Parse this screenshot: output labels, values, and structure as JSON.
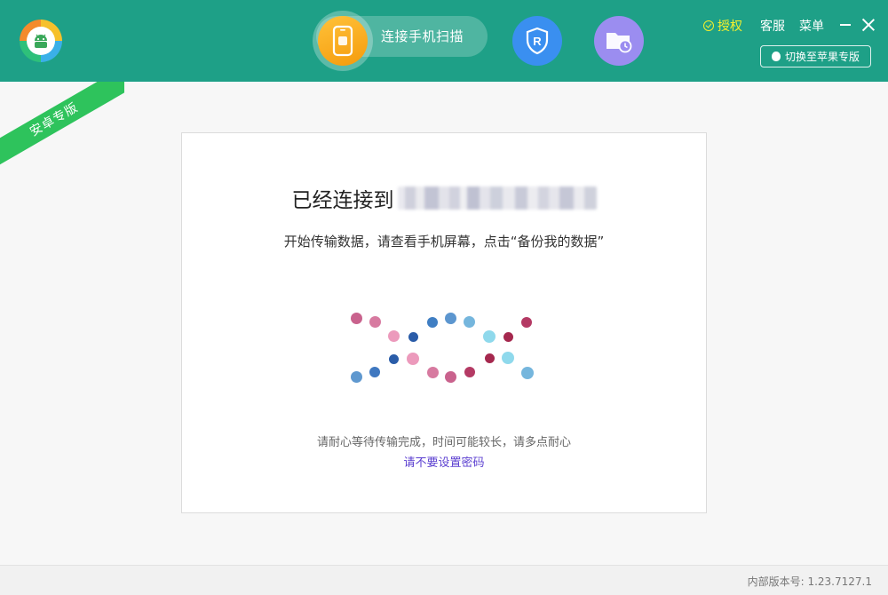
{
  "header": {
    "scan_label": "连接手机扫描",
    "auth_label": "授权",
    "service_label": "客服",
    "menu_label": "菜单",
    "switch_label": "切换至苹果专版"
  },
  "ribbon": {
    "label": "安卓专版"
  },
  "card": {
    "title": "已经连接到",
    "subtitle": "开始传输数据，请查看手机屏幕，点击“备份我的数据”",
    "note": "请耐心等待传输完成，时间可能较长，请多点耐心",
    "password_link": "请不要设置密码"
  },
  "footer": {
    "version": "内部版本号: 1.23.7127.1"
  },
  "colors": {
    "header_bg": "#1ea087",
    "auth": "#f4f02c",
    "ribbon": "#2ec35c",
    "scan_button": "#f7a91b",
    "r_button": "#3a8ff0",
    "history_button": "#9b8df0",
    "link": "#5b3fd0"
  },
  "icons": {
    "logo": "android-logo-icon",
    "scan": "phone-scan-icon",
    "r": "r-shield-icon",
    "history": "folder-clock-icon",
    "auth": "check-circle-icon",
    "apple": "apple-icon"
  }
}
